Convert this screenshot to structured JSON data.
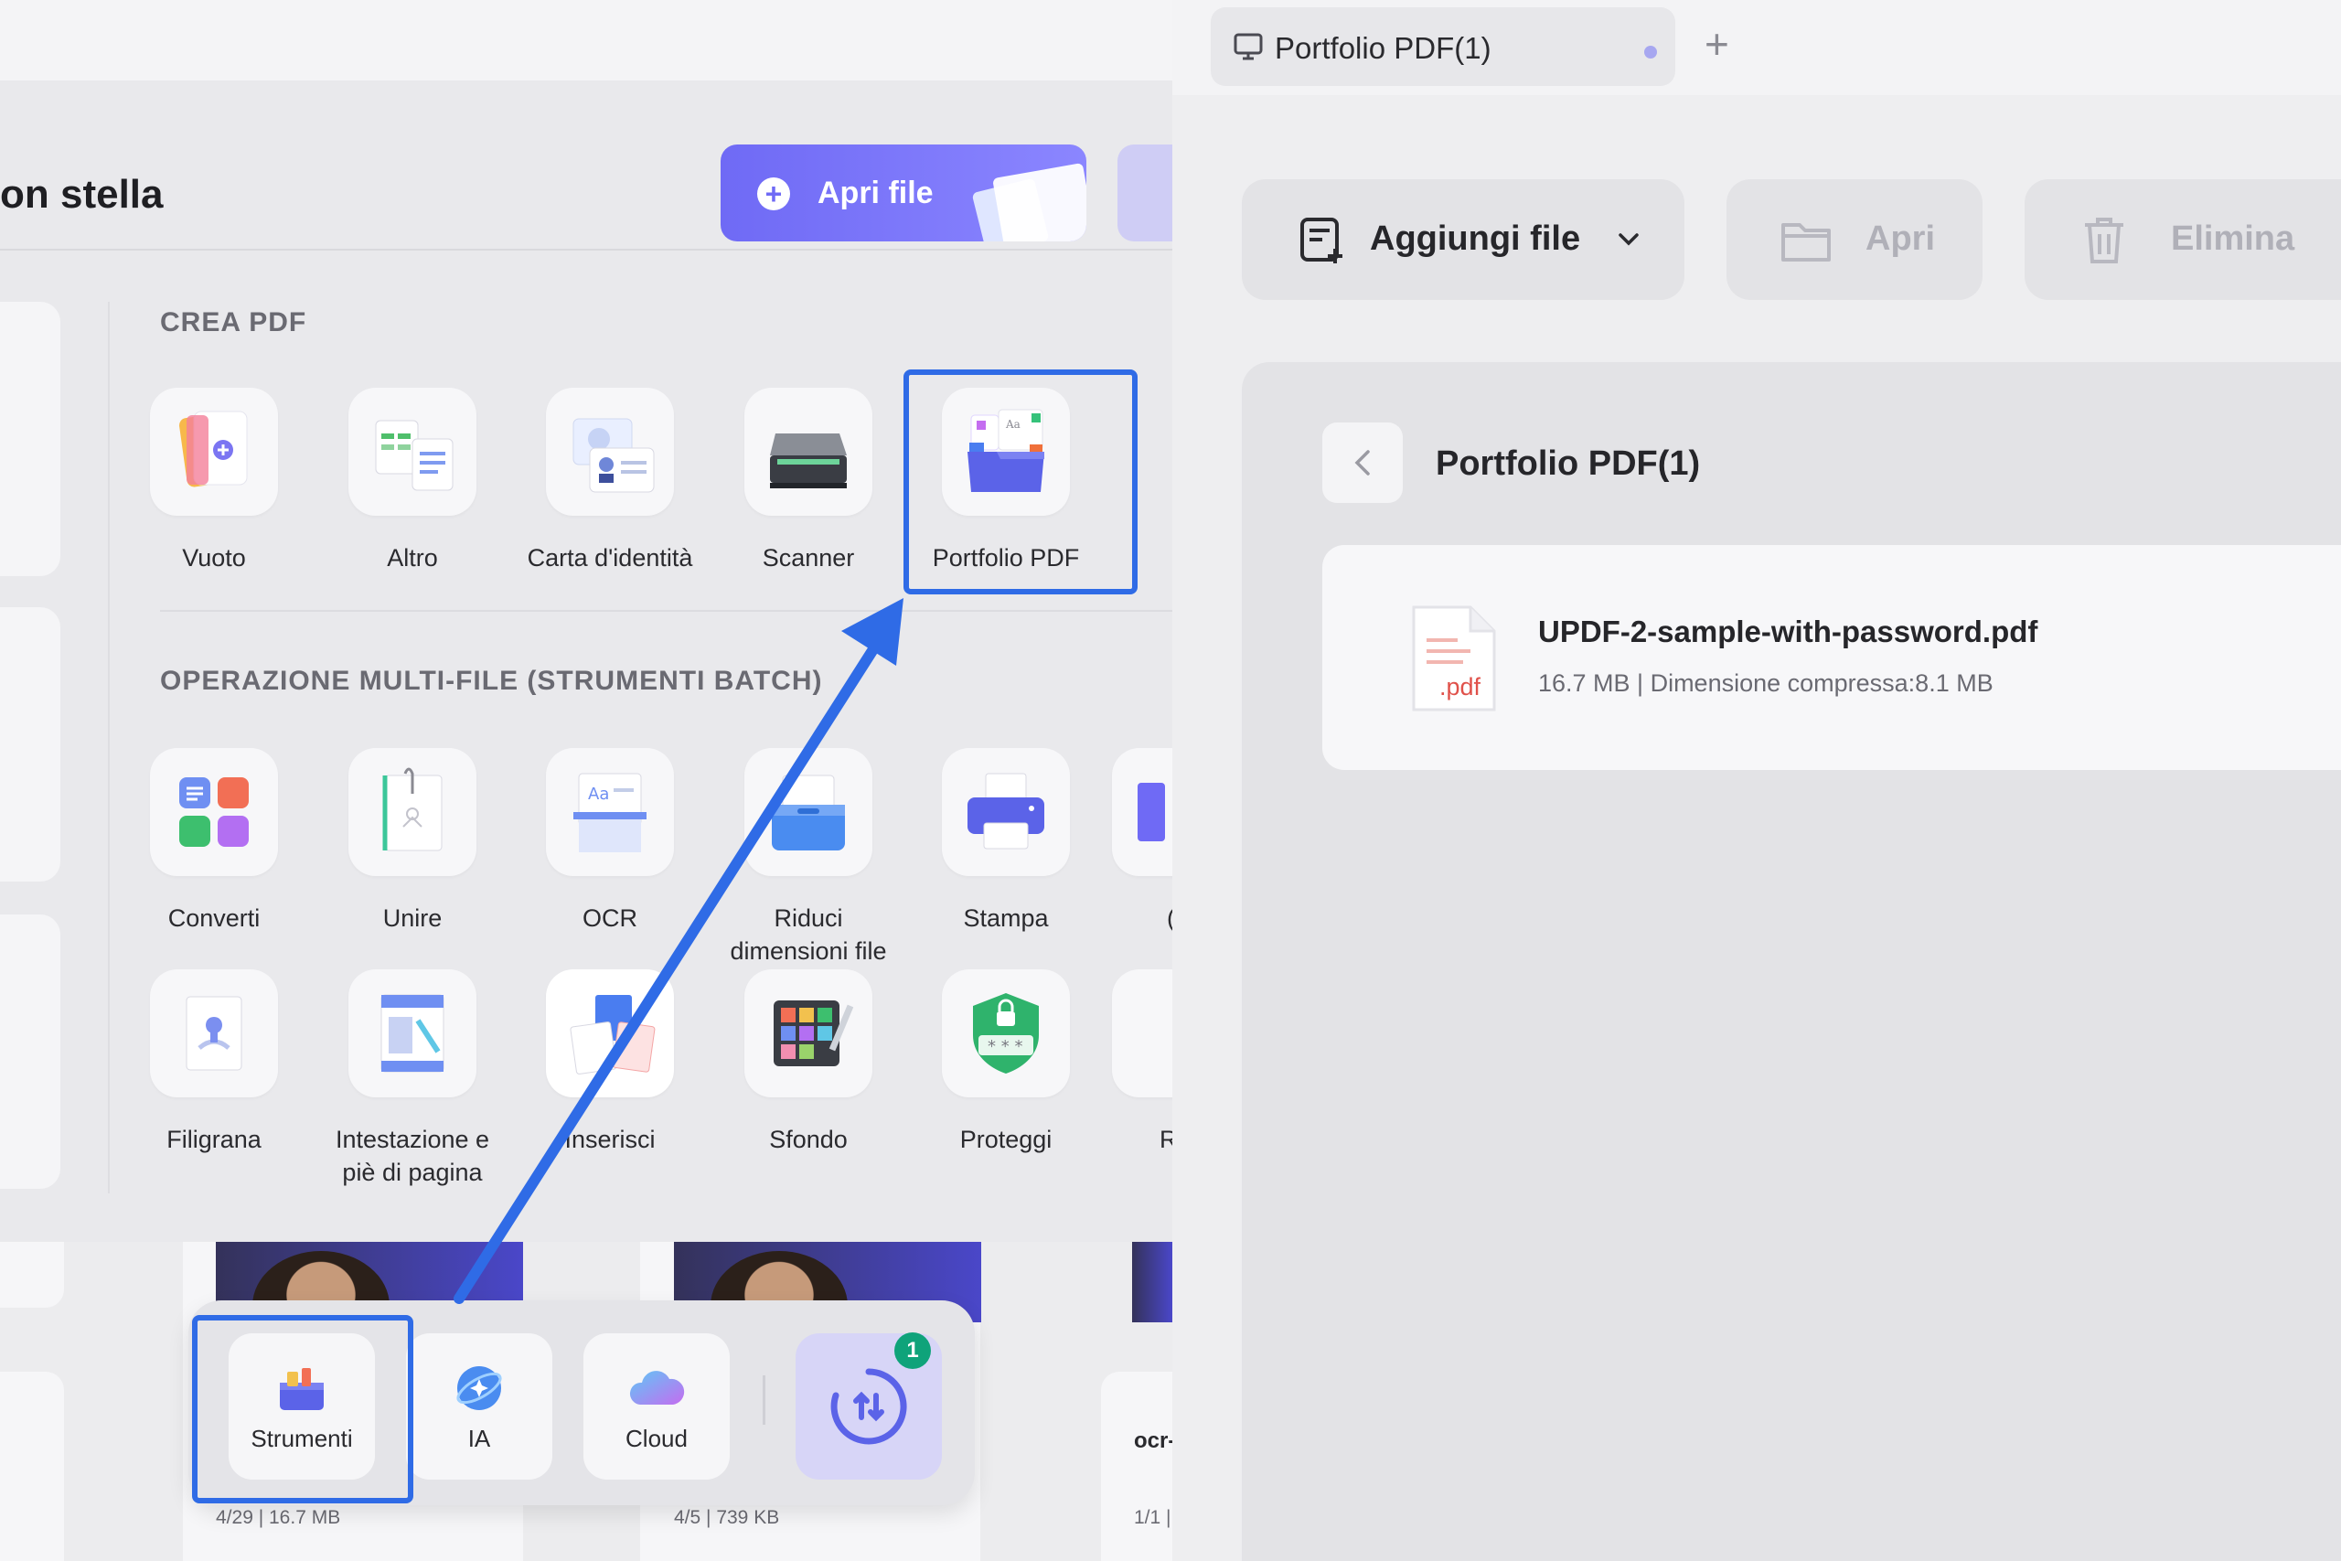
{
  "home": {
    "title_fragment": "on stella",
    "open_button": "Apri file",
    "sections": {
      "create": "CREA PDF",
      "batch": "OPERAZIONE MULTI-FILE (STRUMENTI BATCH)"
    },
    "create_tools": [
      "Vuoto",
      "Altro",
      "Carta d'identità",
      "Scanner",
      "Portfolio PDF"
    ],
    "batch_tools_row1": [
      "Converti",
      "Unire",
      "OCR",
      "Riduci dimensioni file",
      "Stampa"
    ],
    "batch_tools_row2": [
      "Filigrana",
      "Intestazione e piè di pagina",
      "Inserisci",
      "Sfondo",
      "Proteggi"
    ],
    "cut_labels": {
      "row1": "(",
      "row2": "R"
    },
    "files": [
      {
        "meta": "4/29 | 16.7 MB"
      },
      {
        "meta": "4/5 | 739 KB"
      },
      {
        "name": "ocr-",
        "meta": "1/1 |"
      }
    ],
    "dock": {
      "items": [
        "Strumenti",
        "IA",
        "Cloud"
      ],
      "sync_badge": "1"
    }
  },
  "portfolio": {
    "tab_title": "Portfolio PDF(1)",
    "toolbar": {
      "add_files": "Aggiungi file",
      "open": "Apri",
      "delete": "Elimina"
    },
    "panel_title": "Portfolio PDF(1)",
    "file": {
      "name": "UPDF-2-sample-with-password.pdf",
      "info": "16.7 MB | Dimensione compressa:8.1 MB",
      "ext": ".pdf"
    }
  },
  "colors": {
    "accent": "#6f6af5",
    "highlight": "#2f6be6",
    "badge": "#0fa37a"
  }
}
